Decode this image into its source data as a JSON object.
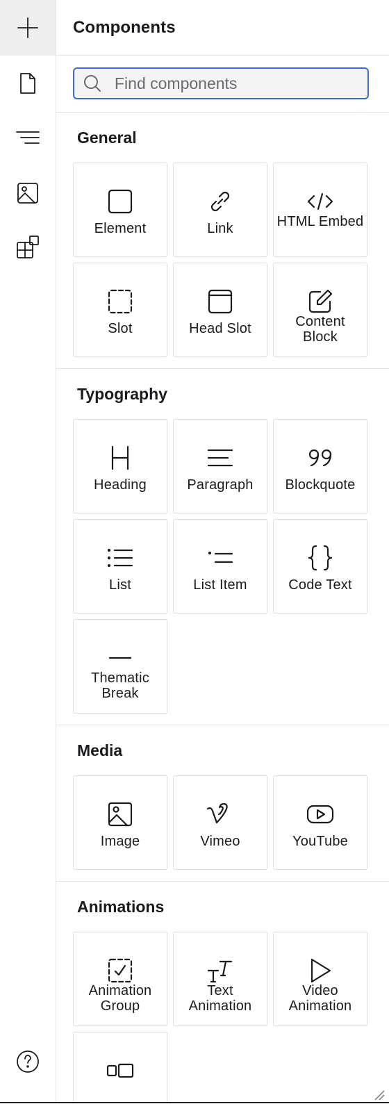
{
  "rail": {
    "items": [
      {
        "icon": "plus-icon",
        "active": true
      },
      {
        "icon": "page-icon"
      },
      {
        "icon": "navigator-icon"
      },
      {
        "icon": "image-icon"
      },
      {
        "icon": "apps-icon"
      }
    ],
    "help_icon": "help-icon"
  },
  "panel": {
    "title": "Components",
    "search": {
      "placeholder": "Find components",
      "value": ""
    }
  },
  "sections": {
    "general": {
      "title": "General",
      "items": [
        "Element",
        "Link",
        "HTML Embed",
        "Slot",
        "Head Slot",
        "Content Block"
      ]
    },
    "typography": {
      "title": "Typography",
      "items": [
        "Heading",
        "Paragraph",
        "Blockquote",
        "List",
        "List Item",
        "Code Text",
        "Thematic Break"
      ]
    },
    "media": {
      "title": "Media",
      "items": [
        "Image",
        "Vimeo",
        "YouTube"
      ]
    },
    "animations": {
      "title": "Animations",
      "items": [
        "Animation Group",
        "Text Animation",
        "Video Animation",
        ""
      ]
    }
  },
  "colors": {
    "accent": "#3b6bd6",
    "border": "#dcdcdc",
    "active_rail": "#eeeeee"
  }
}
